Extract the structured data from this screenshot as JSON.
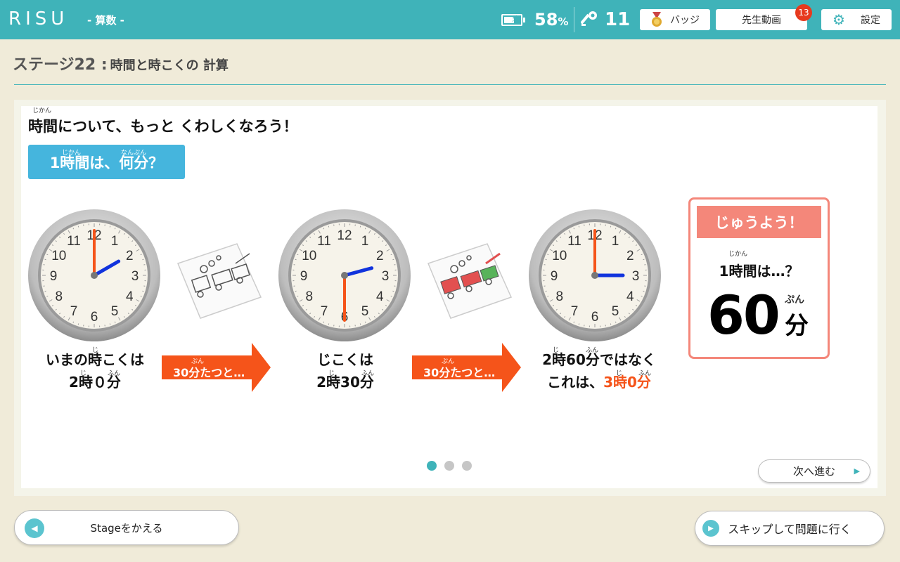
{
  "header": {
    "logo": "RISU",
    "subject": "- 算数 -",
    "battery_percent": "58",
    "battery_unit": "%",
    "keys": "11",
    "badge_label": "バッジ",
    "video_label": "先生動画",
    "video_notifications": "13",
    "settings_label": "設定"
  },
  "stage": {
    "number": "ステージ22 :",
    "title": "時間と時こくの 計算"
  },
  "lesson": {
    "heading": "時間について、もっと くわしくなろう！",
    "heading_ruby": "じかん",
    "question": "1時間は、何分？",
    "question_ruby_1": "じかん",
    "question_ruby_2": "なんぷん",
    "clocks": [
      {
        "hour": 2,
        "minute": 0,
        "line1": "いまの時こくは",
        "line2": "2時０分",
        "ruby_a": "じ",
        "ruby_b": "じ",
        "ruby_c": "ふん"
      },
      {
        "hour": 2,
        "minute": 30,
        "line1": "じこくは",
        "line2": "2時30分",
        "ruby_b": "じ",
        "ruby_c": "ふん"
      },
      {
        "hour": 2,
        "minute": 60,
        "line1": "2時60分ではなく",
        "line2_prefix": "これは、",
        "line2_highlight": "3時0分",
        "ruby_a": "じ",
        "ruby_a2": "ふん",
        "ruby_b": "じ",
        "ruby_c": "ふん"
      }
    ],
    "arrows": [
      {
        "label": "30分たつと…",
        "ruby": "ぷん"
      },
      {
        "label": "30分たつと…",
        "ruby": "ぷん"
      }
    ],
    "important": {
      "header": "じゅうよう！",
      "question": "1時間は…？",
      "question_ruby": "じかん",
      "value": "60",
      "unit": "分",
      "unit_ruby": "ぷん"
    }
  },
  "pagination": {
    "total": 3,
    "current": 1
  },
  "buttons": {
    "next": "次へ進む",
    "change_stage": "Stageをかえる",
    "skip": "スキップして問題に行く"
  },
  "colors": {
    "teal": "#3fb3b9",
    "blue_label": "#45b5dd",
    "orange": "#f5541a",
    "salmon": "#f4877a"
  }
}
